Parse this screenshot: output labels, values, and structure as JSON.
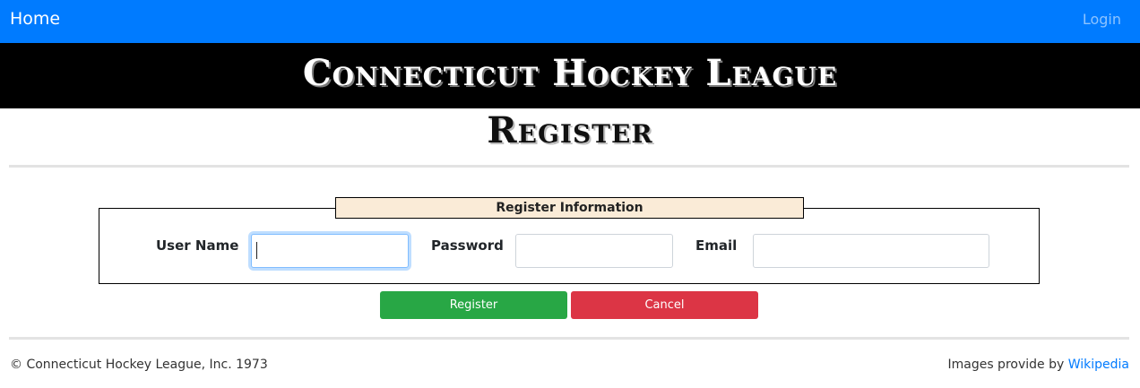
{
  "navbar": {
    "home_label": "Home",
    "login_label": "Login",
    "background_color": "#007bff"
  },
  "banner": {
    "title": "Connecticut Hockey League"
  },
  "page": {
    "title": "Register"
  },
  "form": {
    "legend": "Register Information",
    "fields": [
      {
        "label": "User Name",
        "value": "",
        "focused": true
      },
      {
        "label": "Password",
        "value": ""
      },
      {
        "label": "Email",
        "value": ""
      }
    ],
    "buttons": {
      "register_label": "Register",
      "cancel_label": "Cancel"
    },
    "colors": {
      "register": "#28a745",
      "cancel": "#dc3545",
      "legend_background": "#faebd7"
    }
  },
  "footer": {
    "copyright": "© Connecticut Hockey League, Inc. 1973",
    "credit_prefix": "Images provide by ",
    "credit_link": "Wikipedia"
  }
}
